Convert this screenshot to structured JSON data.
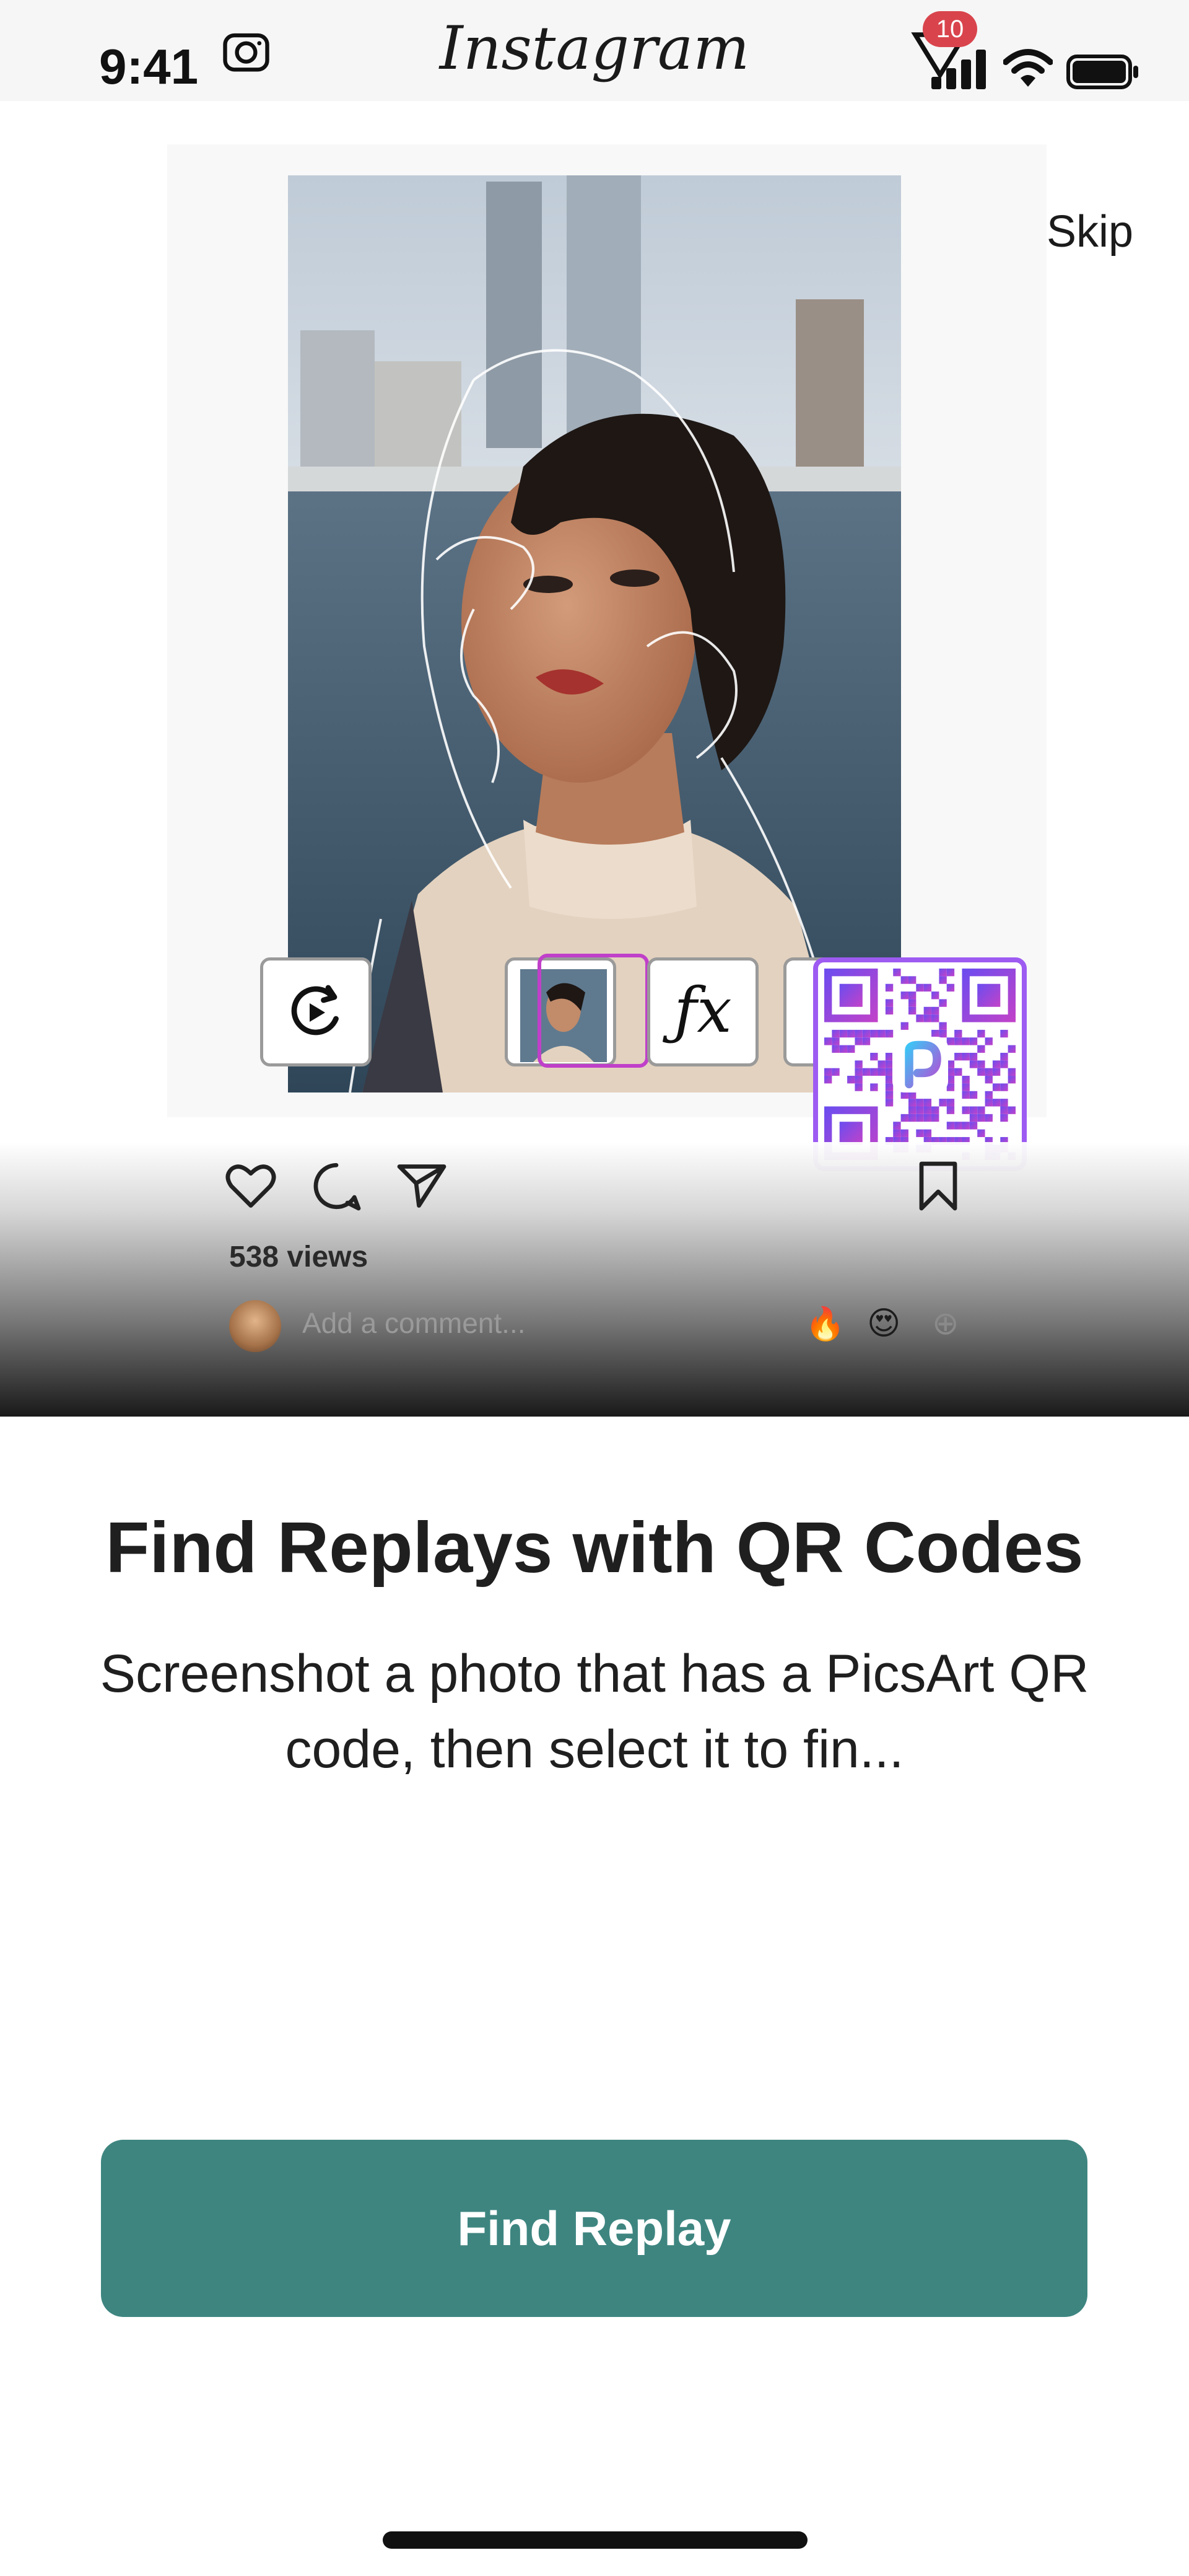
{
  "status_bar": {
    "time": "9:41",
    "app_name": "Instagram",
    "notification_count": "10",
    "icons": [
      "camera-icon",
      "signal-icon",
      "wifi-icon",
      "battery-icon"
    ]
  },
  "hero": {
    "skip_label": "Skip",
    "toolbar_icons": [
      "rotate-icon",
      "photo-thumbnail",
      "fx-icon",
      "more-tool"
    ],
    "fx_label": "ƒx",
    "qr_brand_letter": "P"
  },
  "post": {
    "views": "538 views",
    "comment_placeholder": "Add a comment...",
    "emojis": [
      "🔥",
      "😍",
      "⊕"
    ],
    "icons": [
      "heart-icon",
      "comment-icon",
      "share-icon",
      "bookmark-icon"
    ]
  },
  "content": {
    "headline": "Find Replays with QR Codes",
    "body": "Screenshot a photo that has a PicsArt QR code, then select it to fin..."
  },
  "cta": {
    "label": "Find Replay"
  },
  "colors": {
    "accent": "#3e8580",
    "badge": "#d9444c",
    "qr_border": "#9d5bf2"
  }
}
